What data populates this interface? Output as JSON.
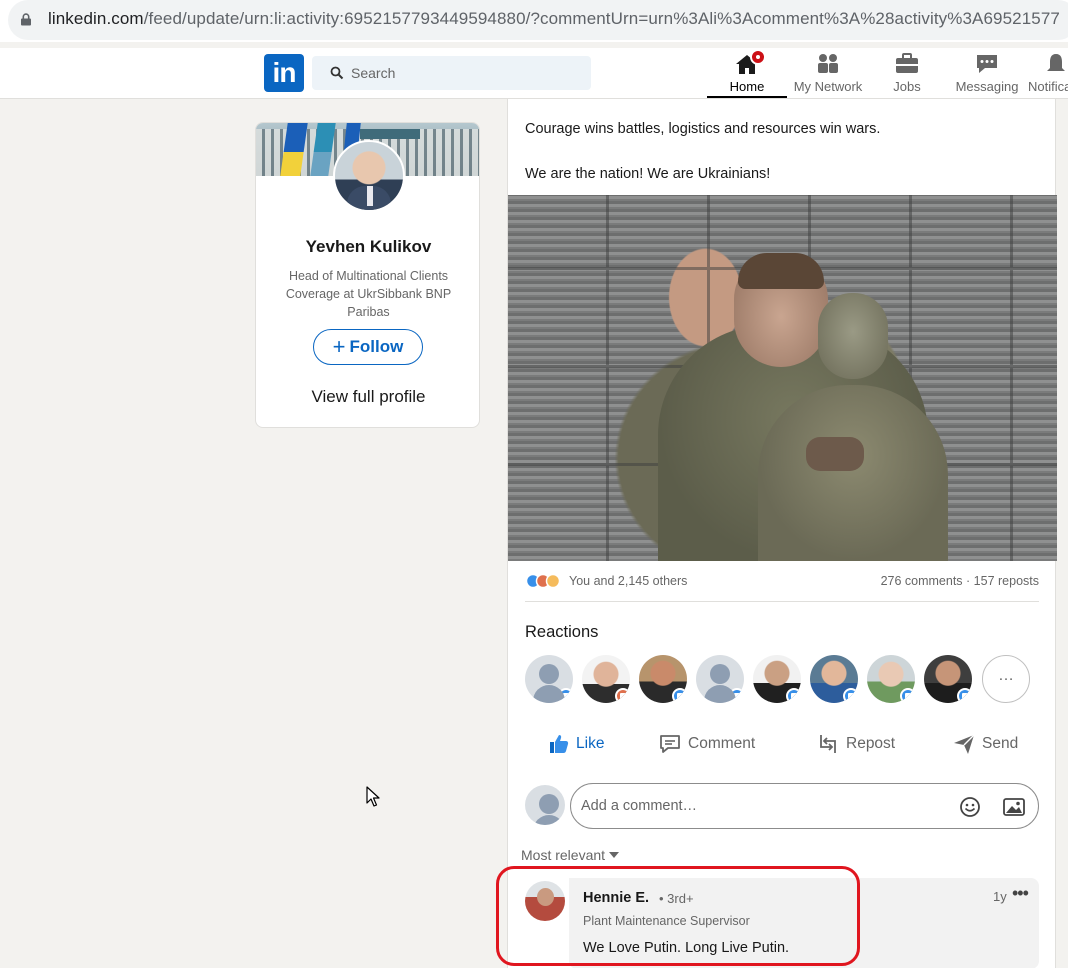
{
  "browser": {
    "url_host": "linkedin.com",
    "url_path": "/feed/update/urn:li:activity:6952157793449594880/?commentUrn=urn%3Ali%3Acomment%3A%28activity%3A69521577"
  },
  "nav": {
    "logo_text": "in",
    "search_placeholder": "Search",
    "items": [
      {
        "label": "Home",
        "icon": "home-icon",
        "active": true
      },
      {
        "label": "My Network",
        "icon": "network-icon"
      },
      {
        "label": "Jobs",
        "icon": "briefcase-icon"
      },
      {
        "label": "Messaging",
        "icon": "chat-icon"
      },
      {
        "label": "Notifica",
        "icon": "bell-icon"
      }
    ]
  },
  "profile": {
    "name": "Yevhen Kulikov",
    "title": "Head of Multinational Clients Coverage at UkrSibbank BNP Paribas",
    "follow_label": "Follow",
    "view_profile_label": "View full profile"
  },
  "post": {
    "text_line1": "Courage wins battles, logistics and resources win wars.",
    "text_line2": "We are the nation! We are Ukrainians!",
    "reactions_summary": "You and 2,145 others",
    "counts": "276 comments · 157 reposts",
    "reactions_title": "Reactions",
    "more_reactions": "…",
    "actions": {
      "like": "Like",
      "comment": "Comment",
      "repost": "Repost",
      "send": "Send"
    },
    "comment_placeholder": "Add a comment…",
    "sort_label": "Most relevant"
  },
  "comment": {
    "author": "Hennie E.",
    "degree": "• 3rd+",
    "role": "Plant Maintenance Supervisor",
    "text": "We Love Putin. Long Live Putin.",
    "time": "1y",
    "more": "•••"
  },
  "colors": {
    "brand": "#0a66c2",
    "highlight": "#e0161f",
    "notification": "#cc1016"
  }
}
